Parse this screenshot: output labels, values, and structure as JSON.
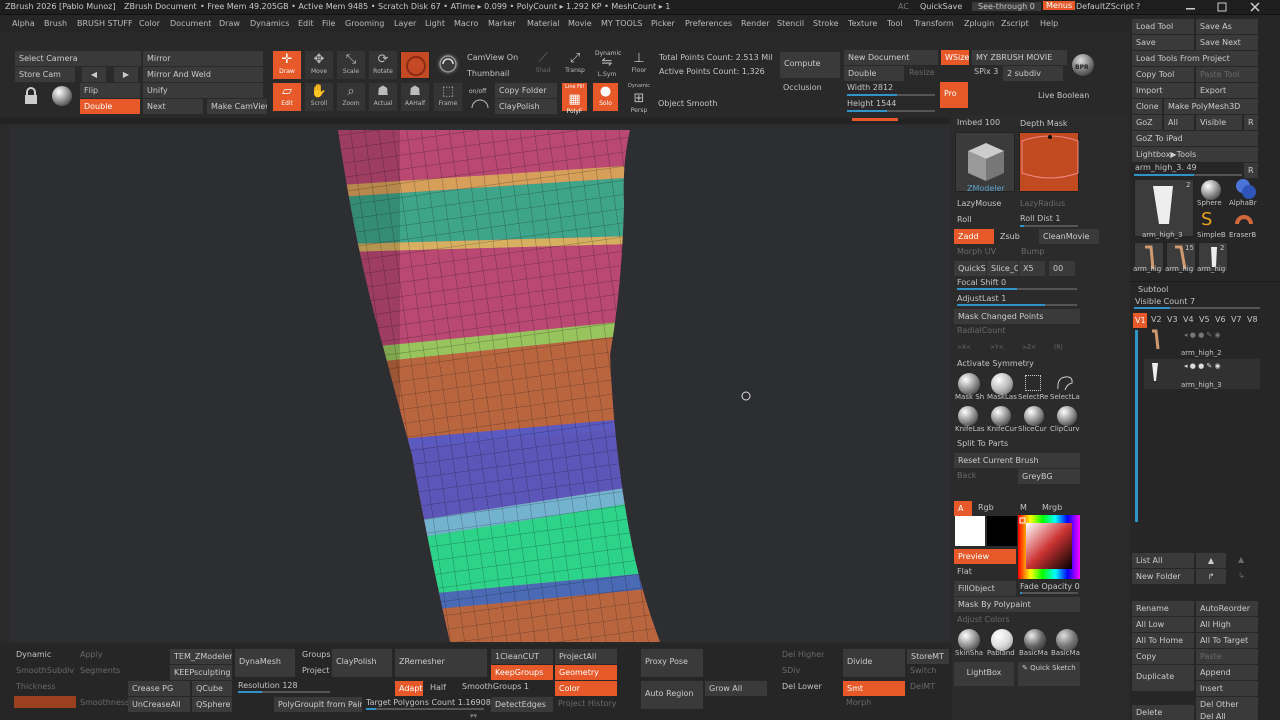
{
  "titlebar": {
    "app": "ZBrush 2026 [Pablo Munoz]",
    "doc": "ZBrush Document",
    "stats": "• Free Mem 49.205GB • Active Mem 9485 • Scratch Disk 67 • ATime ▸ 0.099 • PolyCount ▸ 1.292 KP • MeshCount ▸ 1",
    "ac": "AC",
    "quicksave": "QuickSave",
    "seethrough": "See-through 0",
    "menus": "Menus",
    "defaultzscript": "DefaultZScript",
    "help": "?"
  },
  "menus": [
    "Alpha",
    "Brush",
    "BRUSH STUFF",
    "Color",
    "Document",
    "Draw",
    "Dynamics",
    "Edit",
    "File",
    "Grooming",
    "Layer",
    "Light",
    "Macro",
    "Marker",
    "Material",
    "Movie",
    "MY TOOLS",
    "Picker",
    "Preferences",
    "Render",
    "Stencil",
    "Stroke",
    "Texture",
    "Tool",
    "Transform",
    "Zplugin",
    "Zscript",
    "Help"
  ],
  "top": {
    "select_camera": "Select Camera",
    "store_cam": "Store Cam",
    "prev": "◀",
    "next_arrow": "▶",
    "mirror": "Mirror",
    "mirror_weld": "Mirror And Weld",
    "flip": "Flip",
    "unify": "Unify",
    "double": "Double",
    "next": "Next",
    "make_camview": "Make CamView",
    "draw": "Draw",
    "move": "Move",
    "scale": "Scale",
    "rotate": "Rotate",
    "edit": "Edit",
    "scroll": "Scroll",
    "zoom": "Zoom",
    "actual": "Actual",
    "aahalf": "AAHalf",
    "frame": "Frame",
    "camview_on": "CamView On",
    "thumbnail": "Thumbnail",
    "copy_folder": "Copy Folder",
    "claypolish": "ClayPolish",
    "onoff": "on/off",
    "shad": "Shad",
    "transp": "Transp",
    "dynamic": "Dynamic",
    "lsym": "L.Sym",
    "floor": "Floor",
    "linefill": "Line Fill",
    "polyf": "PolyF",
    "solo": "Solo",
    "dynamic2": "Dynamic",
    "persp": "Persp",
    "object_smooth": "Object Smooth",
    "total_points": "Total Points Count: 2.513 Mil",
    "active_points": "Active Points Count: 1,326",
    "compute": "Compute",
    "occlusion": "Occlusion",
    "new_document": "New Document",
    "wsize": "WSize",
    "double2": "Double",
    "resize": "Resize",
    "width": "Width 2812",
    "height": "Height 1544",
    "my_zbrush_movie": "MY ZBRUSH MOVIE",
    "spix": "SPix 3",
    "subdiv": "2 subdiv",
    "bpr": "BPR",
    "pro": "Pro",
    "live_boolean": "Live Boolean"
  },
  "rightmid": {
    "imbed": "Imbed 100",
    "depth_mask": "Depth Mask",
    "zmodeler": "ZModeler",
    "lazymouse": "LazyMouse",
    "lazyradius": "LazyRadius",
    "roll": "Roll",
    "roll_dist": "Roll Dist 1",
    "zadd": "Zadd",
    "zsub": "Zsub",
    "cleanmovie": "CleanMovie",
    "morph_uv": "Morph UV",
    "bump": "Bump",
    "quicksc": "QuickSc",
    "slice_cu": "Slice_Cu",
    "x5": "X5",
    "oo": "00",
    "focal_shift": "Focal Shift 0",
    "adjustlast": "AdjustLast 1",
    "mask_changed": "Mask Changed Points",
    "radialcount": "RadialCount",
    "xsym": ">X<",
    "ysym": ">Y<",
    "zsym": ">Z<",
    "rsym": "(R)",
    "activate_symmetry": "Activate Symmetry",
    "masksh": "Mask Sh",
    "masklas": "MaskLas",
    "selectre": "SelectRe",
    "selectla": "SelectLa",
    "knifelas": "KnifeLas",
    "knifecu": "KnifeCur",
    "slicecur": "SliceCur",
    "clipcur": "ClipCurv",
    "split_parts": "Split To Parts",
    "reset_brush": "Reset Current Brush",
    "back": "Back",
    "greybg": "GreyBG",
    "a": "A",
    "rgb": "Rgb",
    "m": "M",
    "mrgb": "Mrgb",
    "preview": "Preview",
    "flat": "Flat",
    "fillobject": "FillObject",
    "fade_opacity": "Fade Opacity 0",
    "mask_by_polypaint": "Mask By Polypaint",
    "adjust_colors": "Adjust Colors",
    "skinsha": "SkinSha",
    "pabland": "Pabland",
    "basicma": "BasicMa",
    "basicma2": "BasicMa",
    "lightbox": "LightBox",
    "quick_sketch": "Quick Sketch"
  },
  "rightpanel": {
    "load_tool": "Load Tool",
    "save_as": "Save As",
    "save": "Save",
    "save_next": "Save Next",
    "load_tools_project": "Load Tools From Project",
    "copy_tool": "Copy Tool",
    "paste_tool": "Paste Tool",
    "import": "Import",
    "export": "Export",
    "clone": "Clone",
    "make_polymesh": "Make PolyMesh3D",
    "goz": "GoZ",
    "all": "All",
    "visible": "Visible",
    "r": "R",
    "goz_ipad": "GoZ To iPad",
    "lightbox_tools": "Lightbox▶Tools",
    "current_tool": "arm_high_3. 49",
    "r2": "R",
    "tool_count": "2",
    "sphere": "Sphere",
    "alphabr": "AlphaBr",
    "arm_high_3": "arm_high_3",
    "simpleb": "SimpleB",
    "eraserb": "EraserB",
    "arm_hig1": "arm_hig",
    "arm_hig2": "arm_hig",
    "arm_hig3": "arm_hig",
    "c15": "15",
    "c2": "2",
    "subtool": "Subtool",
    "visible_count": "Visible Count 7",
    "v_tabs": [
      "V1",
      "V2",
      "V3",
      "V4",
      "V5",
      "V6",
      "V7",
      "V8"
    ],
    "subtool1": "arm_high_2",
    "subtool2": "arm_high_3",
    "list_all": "List All",
    "new_folder": "New Folder",
    "rename": "Rename",
    "autoreorder": "AutoReorder",
    "all_low": "All Low",
    "all_high": "All High",
    "all_to_home": "All To Home",
    "all_to_target": "All To Target",
    "copy": "Copy",
    "paste": "Paste",
    "duplicate": "Duplicate",
    "append": "Append",
    "insert": "Insert",
    "delete": "Delete",
    "del_other": "Del Other",
    "del_all": "Del All"
  },
  "bottom": {
    "dynamic": "Dynamic",
    "apply": "Apply",
    "smoothsubdiv": "SmoothSubdiv",
    "segments": "Segments",
    "thickness": "Thickness",
    "smoothness": "Smoothness",
    "tem_zmodeler": "TEM_ZModeler",
    "keepsculpting": "KEEPsculpting",
    "crease_pg": "Crease PG",
    "qcube": "QCube",
    "uncreaseall": "UnCreaseAll",
    "qsphere": "QSphere",
    "dynamesh": "DynaMesh",
    "groups": "Groups",
    "project": "Project",
    "claypolish": "ClayPolish",
    "resolution": "Resolution 128",
    "polygroupit": "PolyGroupIt from Paint",
    "zremesher": "ZRemesher",
    "adapt": "Adapt",
    "half": "Half",
    "target_polys": "Target Polygons Count 1.16908",
    "onecleancut": "1CleanCUT",
    "keepgroups": "KeepGroups",
    "smoothgroups": "SmoothGroups 1",
    "detectedges": "DetectEdges",
    "projectall": "ProjectAll",
    "geometry": "Geometry",
    "color": "Color",
    "project_history": "Project History",
    "proxy_pose": "Proxy Pose",
    "auto_region": "Auto Region",
    "grow_all": "Grow All",
    "del_higher": "Del Higher",
    "sdiv": "SDiv",
    "del_lower": "Del Lower",
    "divide": "Divide",
    "smt": "Smt",
    "storemt": "StoreMT",
    "switch": "Switch",
    "delmt": "DelMT",
    "morph": "Morph"
  },
  "colors": {
    "accent": "#e8592a",
    "slider": "#2f95c9",
    "bg": "#2a2a2a"
  }
}
